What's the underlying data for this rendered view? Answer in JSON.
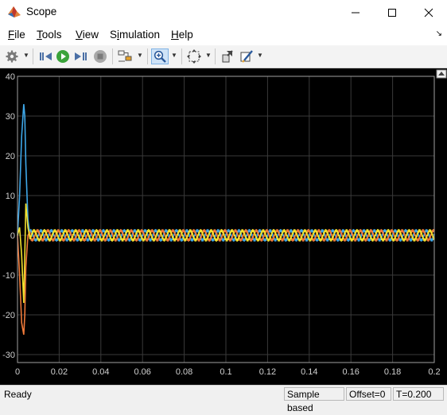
{
  "window": {
    "title": "Scope"
  },
  "menu": [
    {
      "label": "File",
      "accel": "F",
      "rest": "ile"
    },
    {
      "label": "Tools",
      "accel": "T",
      "rest": "ools"
    },
    {
      "label": "View",
      "accel": "V",
      "rest": "iew"
    },
    {
      "label": "Simulation",
      "accel": "i",
      "pre": "S",
      "rest": "mulation"
    },
    {
      "label": "Help",
      "accel": "H",
      "rest": "elp"
    }
  ],
  "toolbar": {
    "icons": [
      "gear-icon",
      "step-back-icon",
      "run-icon",
      "step-forward-icon",
      "stop-icon",
      "signal-select-icon",
      "zoom-icon",
      "autoscale-icon",
      "restore-view-icon",
      "style-icon"
    ]
  },
  "status": {
    "ready": "Ready",
    "mode": "Sample based",
    "offset": "Offset=0",
    "time": "T=0.200"
  },
  "chart_data": {
    "type": "line",
    "title": "",
    "xlabel": "",
    "ylabel": "",
    "xlim": [
      0,
      0.2
    ],
    "ylim": [
      -32,
      40
    ],
    "xticks": [
      "0",
      "0.02",
      "0.04",
      "0.06",
      "0.08",
      "0.1",
      "0.12",
      "0.14",
      "0.16",
      "0.18",
      "0.2"
    ],
    "yticks": [
      "40",
      "30",
      "20",
      "10",
      "0",
      "-10",
      "-20",
      "-30"
    ],
    "grid": true,
    "background": "#000000",
    "series": [
      {
        "color": "#3ea7e8",
        "x": [
          0,
          0.001,
          0.002,
          0.003,
          0.0035,
          0.004,
          0.005,
          0.006,
          0.2
        ],
        "y": [
          0,
          10,
          25,
          33,
          30,
          18,
          4,
          0,
          0
        ],
        "steady_amplitude": 1.2,
        "phase_deg": 0
      },
      {
        "color": "#f07a3a",
        "x": [
          0,
          0.001,
          0.002,
          0.003,
          0.0035,
          0.004,
          0.005,
          0.006,
          0.2
        ],
        "y": [
          0,
          -10,
          -22,
          -25,
          -20,
          -8,
          0,
          1,
          0
        ],
        "steady_amplitude": 1.2,
        "phase_deg": 120
      },
      {
        "color": "#f2e12e",
        "x": [
          0,
          0.001,
          0.002,
          0.003,
          0.0035,
          0.004,
          0.005,
          0.006,
          0.2
        ],
        "y": [
          0,
          2,
          -5,
          -17,
          -5,
          8,
          2,
          -1,
          0
        ],
        "steady_amplitude": 1.2,
        "phase_deg": 240
      }
    ],
    "steady_frequency_hz": 200
  }
}
